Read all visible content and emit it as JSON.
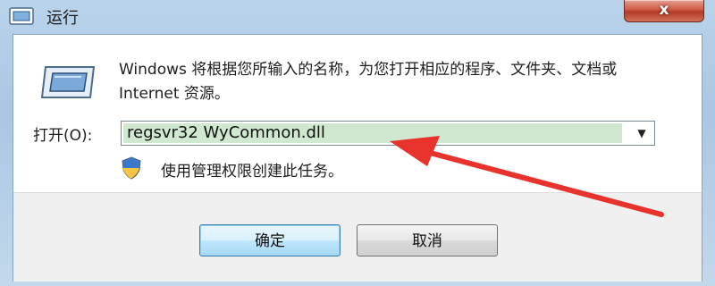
{
  "window": {
    "title": "运行",
    "close_label": "x",
    "app_icon": "run-icon"
  },
  "dialog": {
    "description": "Windows 将根据您所输入的名称，为您打开相应的程序、文件夹、文档或 Internet 资源。",
    "open_label": "打开(O):",
    "command_value": "regsvr32 WyCommon.dll",
    "dropdown_icon": "chevron-down-icon",
    "shield_icon": "uac-shield-icon",
    "admin_note": "使用管理权限创建此任务。",
    "ok_label": "确定",
    "cancel_label": "取消"
  },
  "colors": {
    "annotation_arrow": "#e8322c",
    "input_highlight": "#cfe8cf",
    "default_button_border": "#3c7fb1"
  }
}
